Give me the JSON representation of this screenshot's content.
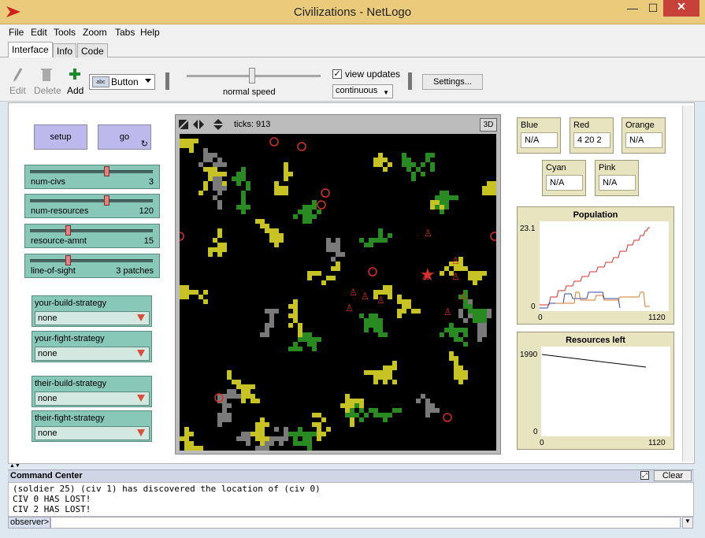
{
  "window": {
    "title": "Civilizations - NetLogo",
    "minimize": "—",
    "maximize": "☐",
    "close": "✕"
  },
  "menu": [
    "File",
    "Edit",
    "Tools",
    "Zoom",
    "Tabs",
    "Help"
  ],
  "tabs": [
    "Interface",
    "Info",
    "Code"
  ],
  "toolbar": {
    "edit": "Edit",
    "delete": "Delete",
    "add": "Add",
    "widget_type": "Button",
    "widget_icon_text": "abc",
    "speed_label": "normal speed",
    "view_updates_label": "view updates",
    "view_updates_checked": true,
    "update_mode": "continuous",
    "settings": "Settings..."
  },
  "buttons": {
    "setup": "setup",
    "go": "go"
  },
  "sliders": [
    {
      "name": "num-civs",
      "value": "3",
      "fraction": 0.62
    },
    {
      "name": "num-resources",
      "value": "120",
      "fraction": 0.62
    },
    {
      "name": "resource-amnt",
      "value": "15",
      "fraction": 0.31
    },
    {
      "name": "line-of-sight",
      "value": "3 patches",
      "fraction": 0.31
    }
  ],
  "choosers": [
    {
      "name": "your-build-strategy",
      "value": "none"
    },
    {
      "name": "your-fight-strategy",
      "value": "none"
    },
    {
      "name": "their-build-strategy",
      "value": "none"
    },
    {
      "name": "their-fight-strategy",
      "value": "none"
    }
  ],
  "view": {
    "ticks_label": "ticks:",
    "ticks": "913",
    "three_d": "3D"
  },
  "monitors": [
    {
      "name": "Blue",
      "value": "N/A"
    },
    {
      "name": "Red",
      "value": "4 20 2"
    },
    {
      "name": "Orange",
      "value": "N/A"
    },
    {
      "name": "Cyan",
      "value": "N/A"
    },
    {
      "name": "Pink",
      "value": "N/A"
    }
  ],
  "population_plot": {
    "title": "Population",
    "ymax": "23.1",
    "ymin": "0",
    "xmin": "0",
    "xmax": "1120"
  },
  "resources_plot": {
    "title": "Resources left",
    "ymax": "1990",
    "ymin": "0",
    "xmin": "0",
    "xmax": "1120"
  },
  "colors": {
    "yellow": "#c8c324",
    "green": "#2a8a22",
    "gray": "#7a7a7a",
    "red": "#d7302b",
    "blue": "#3449a0",
    "orange": "#d77a2a",
    "black_line": "#000000"
  },
  "command_center": {
    "title": "Command Center",
    "clear": "Clear",
    "output": [
      "(soldier 25) (civ 1) has discovered the location of (civ 0)",
      "CIV 0 HAS LOST!",
      "CIV 2 HAS LOST!"
    ],
    "input_label": "observer>"
  }
}
